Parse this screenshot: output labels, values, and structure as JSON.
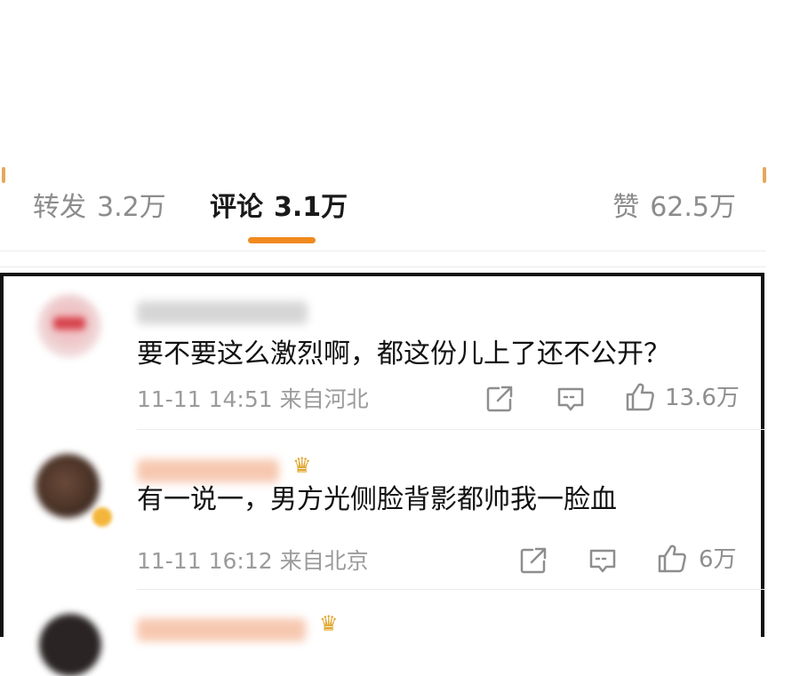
{
  "tabs": {
    "repost": {
      "label": "转发",
      "count": "3.2万"
    },
    "comment": {
      "label": "评论",
      "count": "3.1万"
    },
    "like": {
      "label": "赞",
      "count": "62.5万"
    }
  },
  "comments": [
    {
      "text": "要不要这么激烈啊，都这份儿上了还不公开？",
      "time": "11-11 14:51",
      "location": "来自河北",
      "like_count": "13.6万"
    },
    {
      "text": "有一说一，男方光侧脸背影都帅我一脸血",
      "time": "11-11 16:12",
      "location": "来自北京",
      "like_count": "6万"
    }
  ],
  "icons": {
    "crown": "crown-icon",
    "share": "share-icon",
    "reply": "comment-icon",
    "like": "thumbs-up-icon"
  },
  "colors": {
    "accent": "#f08a1e",
    "frame": "#111111",
    "muted": "#9b9b9b"
  }
}
